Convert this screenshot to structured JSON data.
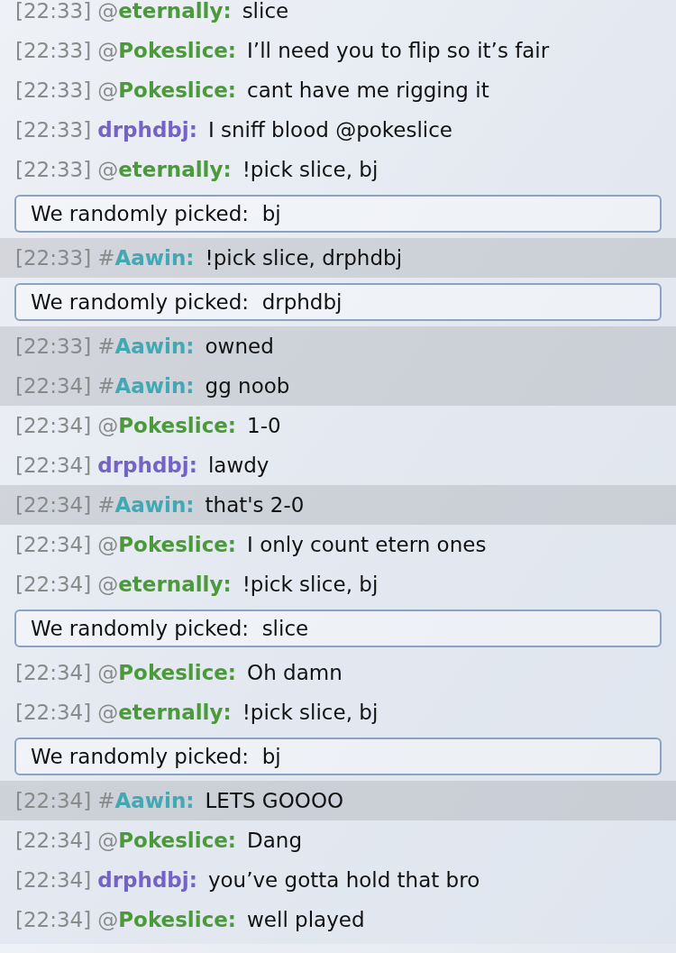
{
  "messages": [
    {
      "kind": "message",
      "time": "[22:33]",
      "prefix": "@",
      "user": "eternally:",
      "color": "#4a9a3a",
      "text": "slice",
      "highlighted": false
    },
    {
      "kind": "message",
      "time": "[22:33]",
      "prefix": "@",
      "user": "Pokeslice:",
      "color": "#4a9a3a",
      "text": "I’ll need you to flip so it’s fair",
      "highlighted": false
    },
    {
      "kind": "message",
      "time": "[22:33]",
      "prefix": "@",
      "user": "Pokeslice:",
      "color": "#4a9a3a",
      "text": "cant have me rigging it",
      "highlighted": false
    },
    {
      "kind": "message",
      "time": "[22:33]",
      "user": "drphdbj:",
      "color": "#7462c6",
      "text": "I sniff blood @pokeslice",
      "highlighted": false
    },
    {
      "kind": "message",
      "time": "[22:33]",
      "prefix": "@",
      "user": "eternally:",
      "color": "#4a9a3a",
      "text": "!pick slice, bj",
      "highlighted": false
    },
    {
      "kind": "notice",
      "text": "We randomly picked:  bj"
    },
    {
      "kind": "message",
      "time": "[22:33]",
      "prefix": "#",
      "user": "Aawin:",
      "color": "#42a8b4",
      "text": "!pick slice, drphdbj",
      "highlighted": true
    },
    {
      "kind": "notice",
      "text": "We randomly picked:  drphdbj"
    },
    {
      "kind": "message",
      "time": "[22:33]",
      "prefix": "#",
      "user": "Aawin:",
      "color": "#42a8b4",
      "text": "owned",
      "highlighted": true
    },
    {
      "kind": "message",
      "time": "[22:34]",
      "prefix": "#",
      "user": "Aawin:",
      "color": "#42a8b4",
      "text": "gg noob",
      "highlighted": true
    },
    {
      "kind": "message",
      "time": "[22:34]",
      "prefix": "@",
      "user": "Pokeslice:",
      "color": "#4a9a3a",
      "text": "1-0",
      "highlighted": false
    },
    {
      "kind": "message",
      "time": "[22:34]",
      "user": "drphdbj:",
      "color": "#7462c6",
      "text": "lawdy",
      "highlighted": false
    },
    {
      "kind": "message",
      "time": "[22:34]",
      "prefix": "#",
      "user": "Aawin:",
      "color": "#42a8b4",
      "text": "that's 2-0",
      "highlighted": true
    },
    {
      "kind": "message",
      "time": "[22:34]",
      "prefix": "@",
      "user": "Pokeslice:",
      "color": "#4a9a3a",
      "text": "I only count etern ones",
      "highlighted": false
    },
    {
      "kind": "message",
      "time": "[22:34]",
      "prefix": "@",
      "user": "eternally:",
      "color": "#4a9a3a",
      "text": "!pick slice, bj",
      "highlighted": false
    },
    {
      "kind": "notice",
      "text": "We randomly picked:  slice"
    },
    {
      "kind": "message",
      "time": "[22:34]",
      "prefix": "@",
      "user": "Pokeslice:",
      "color": "#4a9a3a",
      "text": "Oh damn",
      "highlighted": false
    },
    {
      "kind": "message",
      "time": "[22:34]",
      "prefix": "@",
      "user": "eternally:",
      "color": "#4a9a3a",
      "text": "!pick slice, bj",
      "highlighted": false
    },
    {
      "kind": "notice",
      "text": "We randomly picked:  bj"
    },
    {
      "kind": "message",
      "time": "[22:34]",
      "prefix": "#",
      "user": "Aawin:",
      "color": "#42a8b4",
      "text": "LETS GOOOO",
      "highlighted": true
    },
    {
      "kind": "message",
      "time": "[22:34]",
      "prefix": "@",
      "user": "Pokeslice:",
      "color": "#4a9a3a",
      "text": "Dang",
      "highlighted": false
    },
    {
      "kind": "message",
      "time": "[22:34]",
      "user": "drphdbj:",
      "color": "#7462c6",
      "text": "you’ve gotta hold that bro",
      "highlighted": false
    },
    {
      "kind": "message",
      "time": "[22:34]",
      "prefix": "@",
      "user": "Pokeslice:",
      "color": "#4a9a3a",
      "text": "well played",
      "highlighted": false
    }
  ]
}
